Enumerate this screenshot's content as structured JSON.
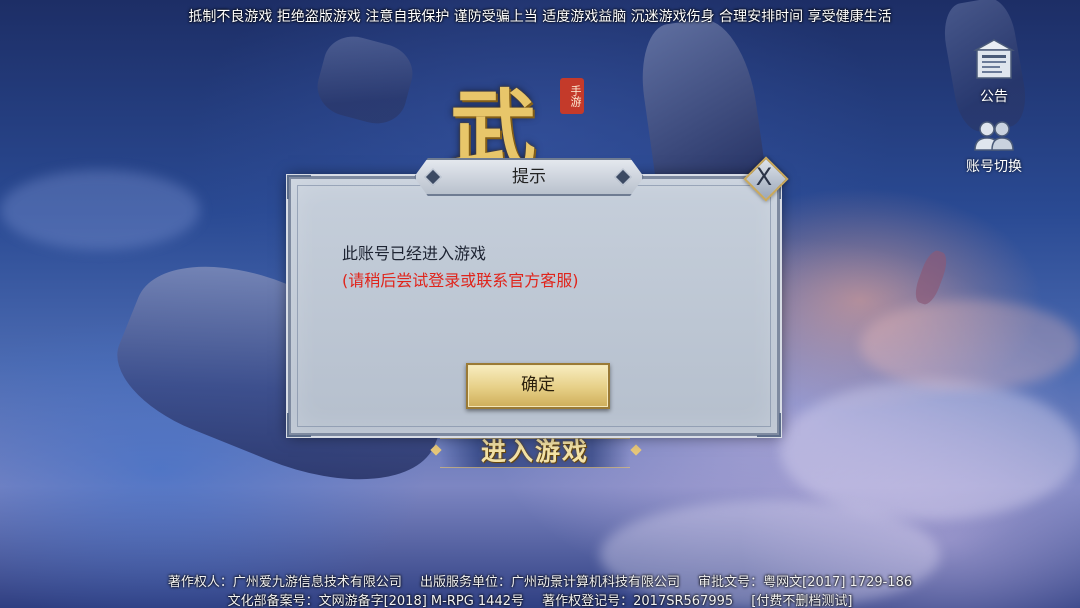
{
  "top_notice": "抵制不良游戏 拒绝盗版游戏 注意自我保护 谨防受骗上当 适度游戏益脑 沉迷游戏伤身 合理安排时间 享受健康生活",
  "side_buttons": {
    "notice": {
      "label": "公告",
      "icon": "notice-board-icon"
    },
    "switch_account": {
      "label": "账号切换",
      "icon": "users-switch-icon"
    }
  },
  "logo": {
    "character": "武",
    "seal": "手游"
  },
  "dialog": {
    "title": "提示",
    "close_glyph": "X",
    "message_line1": "此账号已经进入游戏",
    "message_line2": "(请稍后尝试登录或联系官方客服)",
    "confirm_label": "确定"
  },
  "enter_game_label": "进入游戏",
  "copyright": {
    "line1": [
      "著作权人：广州爱九游信息技术有限公司",
      "出版服务单位：广州动景计算机科技有限公司",
      "审批文号：粤网文[2017] 1729-186"
    ],
    "line2": [
      "文化部备案号：文网游备字[2018] M-RPG 1442号",
      "著作权登记号：2017SR567995",
      "[付费不删档测试]"
    ]
  },
  "colors": {
    "warning_text": "#e0241b",
    "confirm_button": "#e6cf86",
    "dialog_bg": "#c6cfdb"
  }
}
